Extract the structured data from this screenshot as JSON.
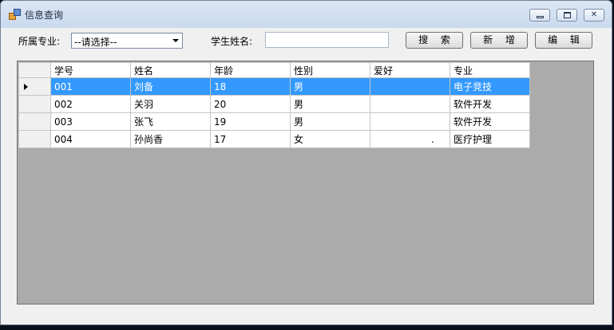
{
  "window": {
    "title": "信息查询"
  },
  "filters": {
    "major_label": "所属专业:",
    "major_selected": "--请选择--",
    "name_label": "学生姓名:",
    "name_value": ""
  },
  "buttons": {
    "search": "搜 索",
    "add": "新 增",
    "edit": "编 辑"
  },
  "table": {
    "columns": [
      "学号",
      "姓名",
      "年龄",
      "性别",
      "爱好",
      "专业"
    ],
    "rows": [
      [
        "001",
        "刘备",
        "18",
        "男",
        "",
        "电子竞技"
      ],
      [
        "002",
        "关羽",
        "20",
        "男",
        "",
        "软件开发"
      ],
      [
        "003",
        "张飞",
        "19",
        "男",
        "",
        "软件开发"
      ],
      [
        "004",
        "孙尚香",
        "17",
        "女",
        ".",
        "医疗护理"
      ]
    ]
  },
  "icons": {
    "app": "app-icon",
    "minimize": "minimize-icon",
    "maximize": "maximize-icon",
    "close": "close-icon",
    "dropdown": "chevron-down-icon",
    "row_pointer": "row-pointer-icon"
  }
}
